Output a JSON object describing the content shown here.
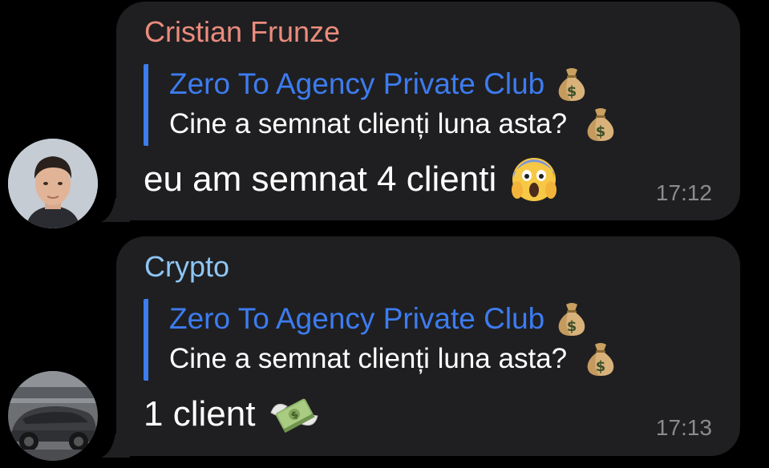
{
  "messages": [
    {
      "sender": "Cristian Frunze",
      "sender_color": "#eb8c7d",
      "reply": {
        "title": "Zero To Agency Private Club",
        "title_emoji": "money-bag-emoji",
        "text": "Cine a semnat clienți luna asta?",
        "text_emoji": "money-bag-emoji"
      },
      "text": "eu am semnat 4 clienti",
      "text_emoji": "face-screaming-in-fear-emoji",
      "time": "17:12",
      "avatar": "profile-photo-young-man"
    },
    {
      "sender": "Crypto",
      "sender_color": "#8ec6f5",
      "reply": {
        "title": "Zero To Agency Private Club",
        "title_emoji": "money-bag-emoji",
        "text": "Cine a semnat clienți luna asta?",
        "text_emoji": "money-bag-emoji"
      },
      "text": "1 client",
      "text_emoji": "money-with-wings-emoji",
      "time": "17:13",
      "avatar": "profile-photo-dark-car"
    }
  ],
  "colors": {
    "background": "#000000",
    "bubble": "#1f1f21",
    "reply_accent": "#3c7ded",
    "timestamp": "#8b8b8f"
  }
}
